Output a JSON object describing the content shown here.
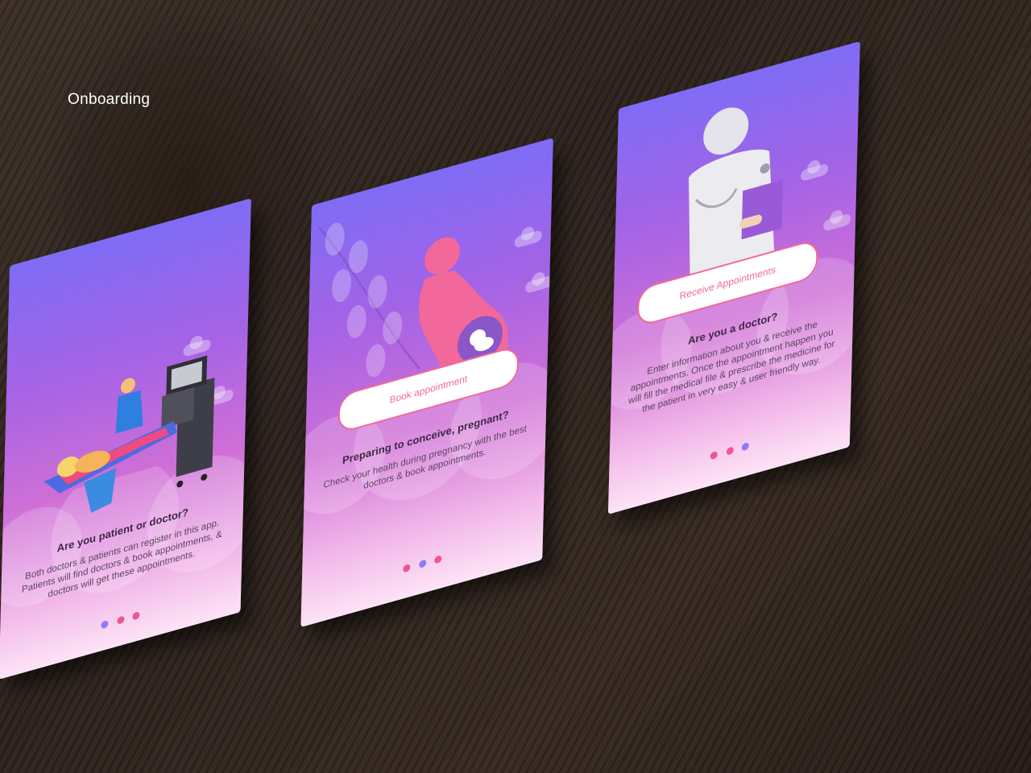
{
  "page": {
    "heading": "Onboarding"
  },
  "screens": [
    {
      "title": "Are you patient or doctor?",
      "body": "Both doctors & patients can register in this app. Patients will find doctors & book appointments, & doctors will get these appointments.",
      "dots": [
        "#8f7af5",
        "#f0568e",
        "#f0568e"
      ]
    },
    {
      "cta_label": "Book appointment",
      "title": "Preparing to conceive, pregnant?",
      "body": "Check your health during pregnancy with the best doctors & book appointments.",
      "dots": [
        "#f0568e",
        "#8f7af5",
        "#f0568e"
      ]
    },
    {
      "cta_label": "Receive Appointments",
      "title": "Are you a doctor?",
      "body": "Enter information about you & receive the appointments. Once the appointment happen you will fill the medical file & prescribe the medicine for the patient in very easy & user friendly way.",
      "dots": [
        "#f0568e",
        "#f0568e",
        "#8f7af5"
      ]
    }
  ],
  "colors": {
    "accent_pink": "#f0568e",
    "accent_purple": "#8f7af5",
    "gradient_top": "#7f6cf5",
    "gradient_bottom": "#fde3f6"
  },
  "icons": [
    "ultrasound-illustration",
    "pregnant-woman-icon",
    "doctor-illustration",
    "leaf-branch-icon",
    "cloud-icon"
  ]
}
